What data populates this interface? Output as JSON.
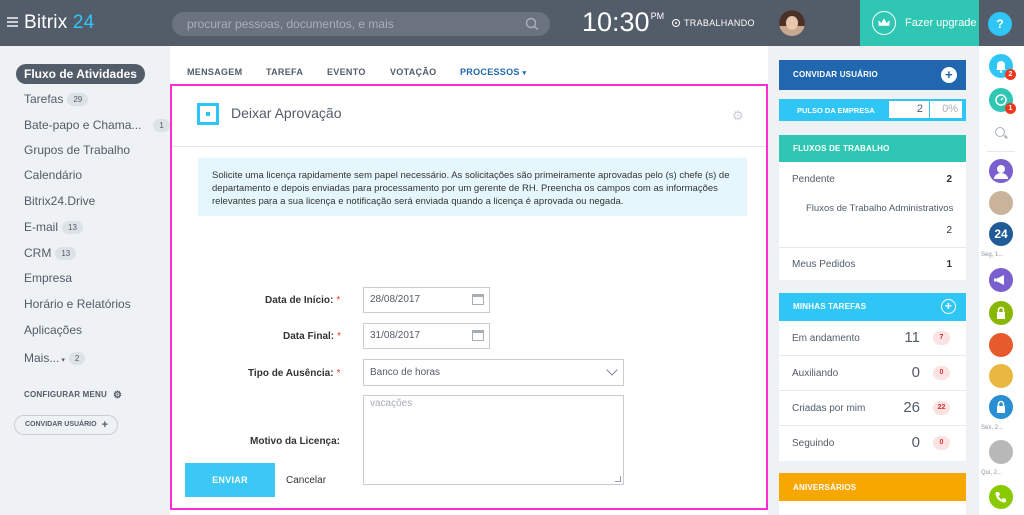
{
  "header": {
    "logo_name": "Bitrix",
    "logo_num": "24",
    "search_placeholder": "procurar pessoas, documentos, e mais",
    "clock_time": "10:30",
    "clock_ampm": "PM",
    "work_status": "TRABALHANDO",
    "upgrade_label": "Fazer upgrade",
    "help_label": "?"
  },
  "sidebar": {
    "items": [
      {
        "label": "Fluxo de Atividades",
        "badge": ""
      },
      {
        "label": "Tarefas",
        "badge": "29"
      },
      {
        "label": "Bate-papo e Chama...",
        "badge": "1"
      },
      {
        "label": "Grupos de Trabalho",
        "badge": ""
      },
      {
        "label": "Calendário",
        "badge": ""
      },
      {
        "label": "Bitrix24.Drive",
        "badge": ""
      },
      {
        "label": "E-mail",
        "badge": "13"
      },
      {
        "label": "CRM",
        "badge": "13"
      },
      {
        "label": "Empresa",
        "badge": ""
      },
      {
        "label": "Horário e Relatórios",
        "badge": ""
      },
      {
        "label": "Aplicações",
        "badge": ""
      },
      {
        "label": "Mais...",
        "badge": "2"
      }
    ],
    "config_menu": "CONFIGURAR MENU",
    "invite_user": "CONVIDAR USUÁRIO"
  },
  "tabs": [
    {
      "label": "MENSAGEM"
    },
    {
      "label": "TAREFA"
    },
    {
      "label": "EVENTO"
    },
    {
      "label": "VOTAÇÃO"
    },
    {
      "label": "PROCESSOS"
    }
  ],
  "form": {
    "title": "Deixar Aprovação",
    "info": "Solicite uma licença rapidamente sem papel necessário. As solicitações são primeiramente aprovadas pelo (s) chefe (s) de departamento e depois enviadas para processamento por um gerente de RH. Preencha os campos com as informações relevantes para a sua licença e notificação será enviada quando a licença é aprovada ou negada.",
    "start_label": "Data de Início:",
    "start_value": "28/08/2017",
    "end_label": "Data Final:",
    "end_value": "31/08/2017",
    "type_label": "Tipo de Ausência:",
    "type_value": "Banco de horas",
    "reason_label": "Motivo da Licença:",
    "reason_value": "vacações",
    "required_mark": "*",
    "send_label": "ENVIAR",
    "cancel_label": "Cancelar"
  },
  "right": {
    "invite_title": "CONVIDAR USUÁRIO",
    "pulse_title": "PULSO DA EMPRESA",
    "pulse_value": "2",
    "pulse_percent": "0%",
    "workflows_title": "FLUXOS DE TRABALHO",
    "wf_pending": "Pendente",
    "wf_pending_val": "2",
    "wf_admin": "Fluxos de Trabalho Administrativos",
    "wf_admin_val": "2",
    "wf_mine": "Meus Pedidos",
    "wf_mine_val": "1",
    "tasks_title": "MINHAS TAREFAS",
    "tasks": [
      {
        "name": "Em andamento",
        "num": "11",
        "count": "7"
      },
      {
        "name": "Auxiliando",
        "num": "0",
        "count": "0"
      },
      {
        "name": "Criadas por mim",
        "num": "26",
        "count": "22"
      },
      {
        "name": "Seguindo",
        "num": "0",
        "count": "0"
      }
    ],
    "birthdays_title": "ANIVERSÁRIOS"
  },
  "rightbar": {
    "notif_count": "2",
    "chat_count": "1",
    "label_seg": "Seg, 1...",
    "label_sex": "Sex, 2...",
    "label_qui": "Qui, 2..."
  },
  "colors": {
    "topbar": "#535c69",
    "accent": "#2fc6f6",
    "upgrade": "#2fc7b3",
    "frame_highlight": "#ff2dd4",
    "invite": "#2067b0",
    "birthdays": "#f7a700"
  }
}
